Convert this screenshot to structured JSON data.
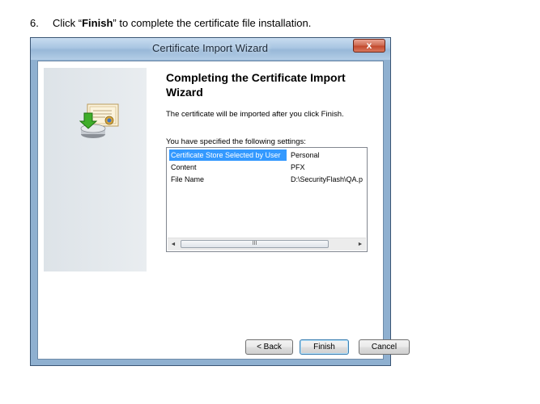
{
  "instruction": {
    "number": "6.",
    "prefix": "Click “",
    "bold": "Finish",
    "suffix": "” to complete the certificate file installation."
  },
  "window": {
    "title": "Certificate Import Wizard",
    "close_label": "x"
  },
  "content": {
    "heading": "Completing the Certificate Import Wizard",
    "description": "The certificate will be imported after you click Finish.",
    "settings_label": "You have specified the following settings:"
  },
  "settings": [
    {
      "key": "Certificate Store Selected by User",
      "value": "Personal",
      "selected": true
    },
    {
      "key": "Content",
      "value": "PFX",
      "selected": false
    },
    {
      "key": "File Name",
      "value": "D:\\SecurityFlash\\QA.p",
      "selected": false
    }
  ],
  "scrollbar": {
    "left_arrow": "◄",
    "right_arrow": "►",
    "thumb_grip": "III"
  },
  "buttons": {
    "back": "< Back",
    "finish": "Finish",
    "cancel": "Cancel"
  },
  "icons": {
    "certificate": "certificate-import-icon",
    "close": "close-icon"
  },
  "colors": {
    "selection": "#3399ff",
    "close_button": "#c34a2e",
    "window_frame": "#8fb0d0"
  }
}
